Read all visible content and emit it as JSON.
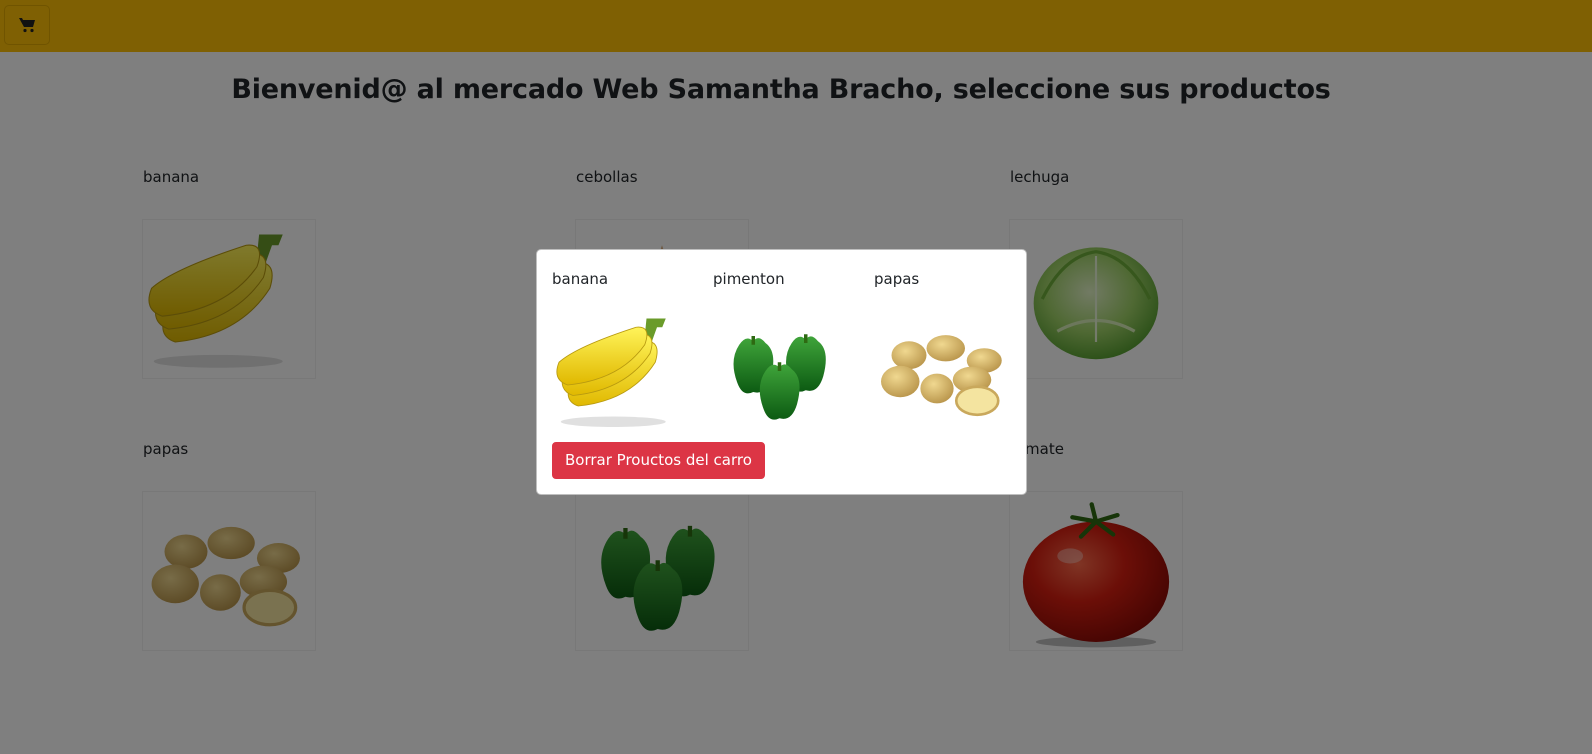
{
  "navbar": {
    "cart_icon": "cart-icon",
    "color": "#ffc107"
  },
  "page": {
    "title": "Bienvenid@ al mercado Web Samantha Bracho, seleccione sus productos"
  },
  "products": [
    {
      "name": "banana",
      "image": "banana-image"
    },
    {
      "name": "cebollas",
      "image": "onion-image"
    },
    {
      "name": "lechuga",
      "image": "lettuce-image"
    },
    {
      "name": "papas",
      "image": "potatoes-image"
    },
    {
      "name": "pimenton",
      "image": "pepper-image"
    },
    {
      "name": "tomate",
      "image": "tomato-image"
    }
  ],
  "cart_modal": {
    "items": [
      {
        "name": "banana",
        "image": "banana-image"
      },
      {
        "name": "pimenton",
        "image": "pepper-image"
      },
      {
        "name": "papas",
        "image": "potatoes-image"
      }
    ],
    "clear_button": "Borrar Prouctos del carro",
    "clear_button_color": "#dc3545"
  }
}
